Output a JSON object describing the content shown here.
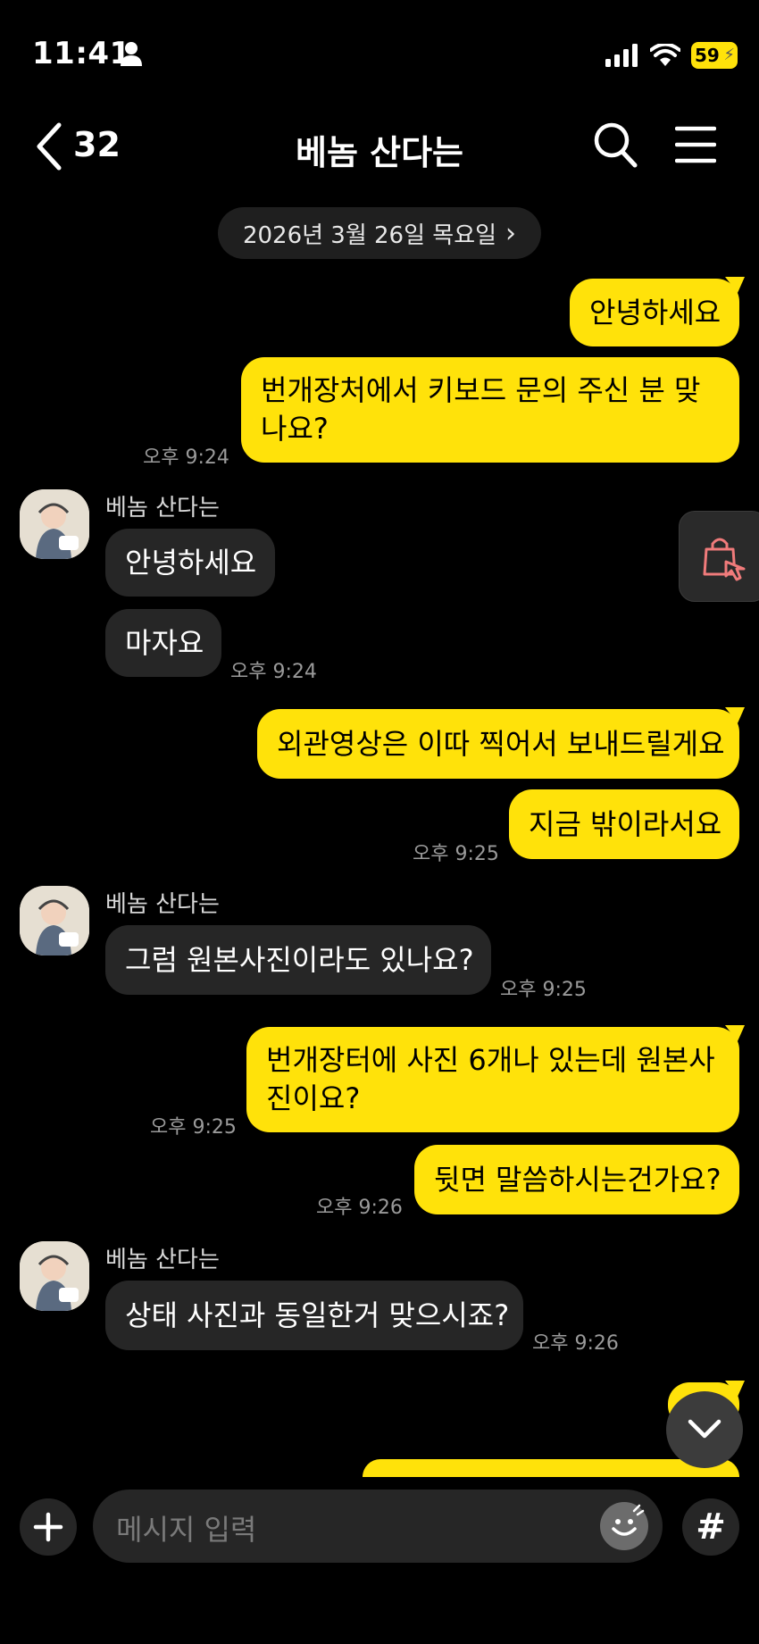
{
  "status_bar": {
    "time": "11:41",
    "battery": "59"
  },
  "header": {
    "back_count": "32",
    "title": "베놈 산다는"
  },
  "date_divider": {
    "label": "2026년 3월 26일 목요일",
    "chevron": "›"
  },
  "messages": [
    {
      "from": "me",
      "text": "안녕하세요"
    },
    {
      "from": "me",
      "text": "번개장처에서 키보드 문의 주신 분 맞나요?",
      "time": "오후 9:24"
    },
    {
      "from": "them",
      "sender": "베놈 산다는",
      "text": "안녕하세요"
    },
    {
      "from": "them",
      "text": "마자요",
      "time": "오후 9:24"
    },
    {
      "from": "me",
      "text": "외관영상은 이따 찍어서 보내드릴게요"
    },
    {
      "from": "me",
      "text": "지금 밖이라서요",
      "time": "오후 9:25"
    },
    {
      "from": "them",
      "sender": "베놈 산다는",
      "text": "그럼 원본사진이라도 있나요?",
      "time": "오후 9:25"
    },
    {
      "from": "me",
      "text": " 번개장터에 사진 6개나 있는데 원본사진이요?",
      "time": "오후 9:25"
    },
    {
      "from": "me",
      "text": "뒷면 말씀하시는건가요?",
      "time": "오후 9:26"
    },
    {
      "from": "them",
      "sender": "베놈 산다는",
      "text": "상태 사진과 동일한거 맞으시죠?",
      "time": "오후 9:26"
    }
  ],
  "input": {
    "placeholder": "메시지 입력",
    "hash_label": "#"
  },
  "icons": {
    "back": "chevron-left-icon",
    "search": "search-icon",
    "menu": "hamburger-menu-icon",
    "shop": "shopping-bag-tap-icon",
    "scroll_down": "chevron-down-icon",
    "plus": "plus-icon",
    "emoji": "emoji-icon"
  },
  "colors": {
    "my_bubble": "#ffe20a",
    "their_bubble": "#262626",
    "background": "#000000"
  }
}
